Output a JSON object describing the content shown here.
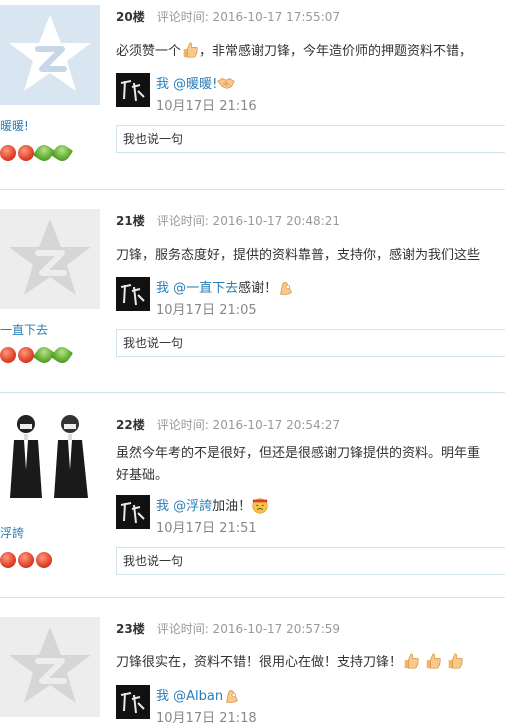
{
  "posts": [
    {
      "floor": "20楼",
      "time_label": "评论时间: 2016-10-17 17:55:07",
      "content": "必须赞一个",
      "content_after": "，非常感谢刀锋，今年造价师的押题资料不错，",
      "user": "暖暖!",
      "reply": {
        "me": "我",
        "at": "@暖暖!",
        "text": "",
        "time": "10月17日 21:16"
      },
      "reply_box": "我也说一句",
      "medals": [
        "red",
        "red",
        "green",
        "green"
      ]
    },
    {
      "floor": "21楼",
      "time_label": "评论时间: 2016-10-17 20:48:21",
      "content": "刀锋，服务态度好，提供的资料靠普，支持你，感谢为我们这些",
      "content_after": "",
      "user": "一直下去",
      "reply": {
        "me": "我",
        "at": "@一直下去",
        "text": "感谢！",
        "time": "10月17日 21:05"
      },
      "reply_box": "我也说一句",
      "medals": [
        "red",
        "red",
        "green",
        "green"
      ]
    },
    {
      "floor": "22楼",
      "time_label": "评论时间: 2016-10-17 20:54:27",
      "content": "虽然今年考的不是很好，但还是很感谢刀锋提供的资料。明年重",
      "content_line2": "好基础。",
      "user": "浮誇",
      "reply": {
        "me": "我",
        "at": "@浮誇",
        "text": "加油！",
        "time": "10月17日 21:51"
      },
      "reply_box": "我也说一句",
      "medals": [
        "red",
        "red",
        "red"
      ]
    },
    {
      "floor": "23楼",
      "time_label": "评论时间: 2016-10-17 20:57:59",
      "content": "刀锋很实在，资料不错！很用心在做！支持刀锋！",
      "content_after": "",
      "user": "",
      "reply": {
        "me": "我",
        "at": "@Alban",
        "text": "",
        "time": "10月17日 21:18"
      },
      "reply_box": "",
      "medals": []
    }
  ]
}
